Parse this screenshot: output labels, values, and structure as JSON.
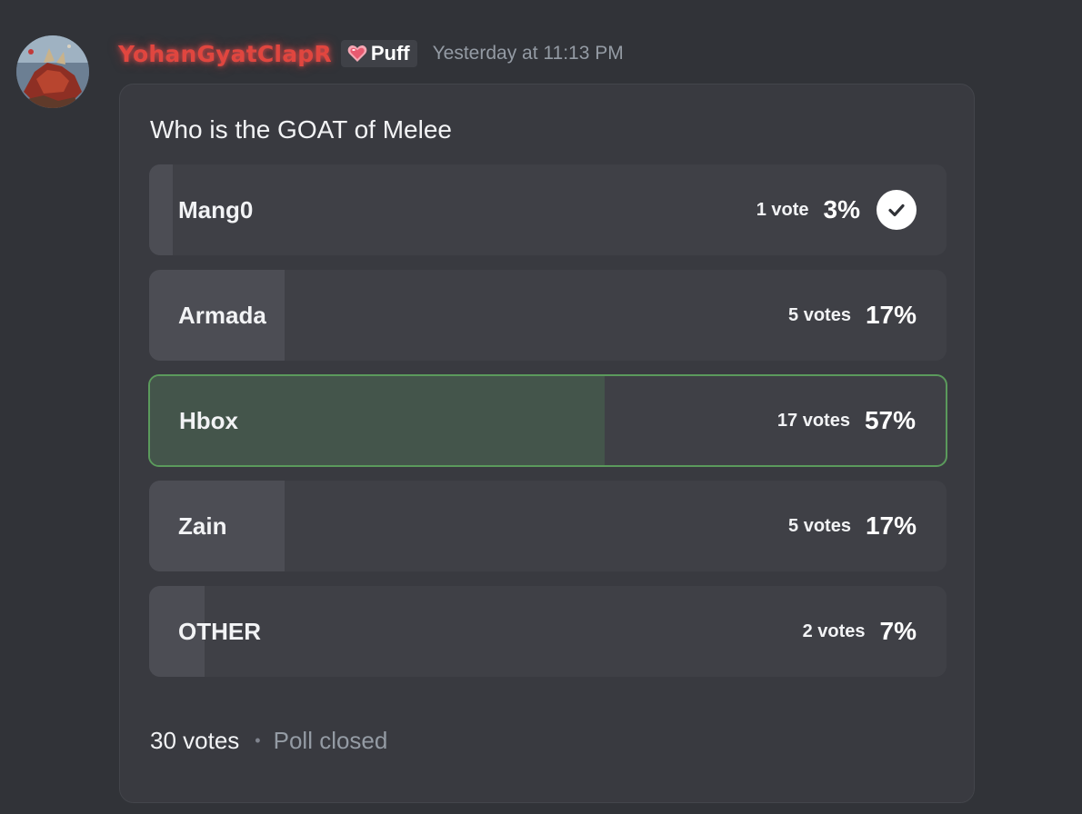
{
  "message": {
    "username": "YohanGyatClapR",
    "tag": {
      "icon": "heart-icon",
      "label": "Puff"
    },
    "timestamp": "Yesterday at 11:13 PM"
  },
  "poll": {
    "question": "Who is the GOAT of Melee",
    "answers": [
      {
        "label": "Mang0",
        "votes": "1 vote",
        "percent": "3%",
        "fraction": 0.03,
        "voted": true,
        "winner": false
      },
      {
        "label": "Armada",
        "votes": "5 votes",
        "percent": "17%",
        "fraction": 0.17,
        "voted": false,
        "winner": false
      },
      {
        "label": "Hbox",
        "votes": "17 votes",
        "percent": "57%",
        "fraction": 0.57,
        "voted": false,
        "winner": true
      },
      {
        "label": "Zain",
        "votes": "5 votes",
        "percent": "17%",
        "fraction": 0.17,
        "voted": false,
        "winner": false
      },
      {
        "label": "OTHER",
        "votes": "2 votes",
        "percent": "7%",
        "fraction": 0.07,
        "voted": false,
        "winner": false
      }
    ],
    "total_votes": "30 votes",
    "separator": "•",
    "status": "Poll closed"
  },
  "colors": {
    "background": "#313338",
    "username": "#e0463f",
    "winner_border": "#5b9a5c",
    "winner_fill": "#44554b"
  }
}
